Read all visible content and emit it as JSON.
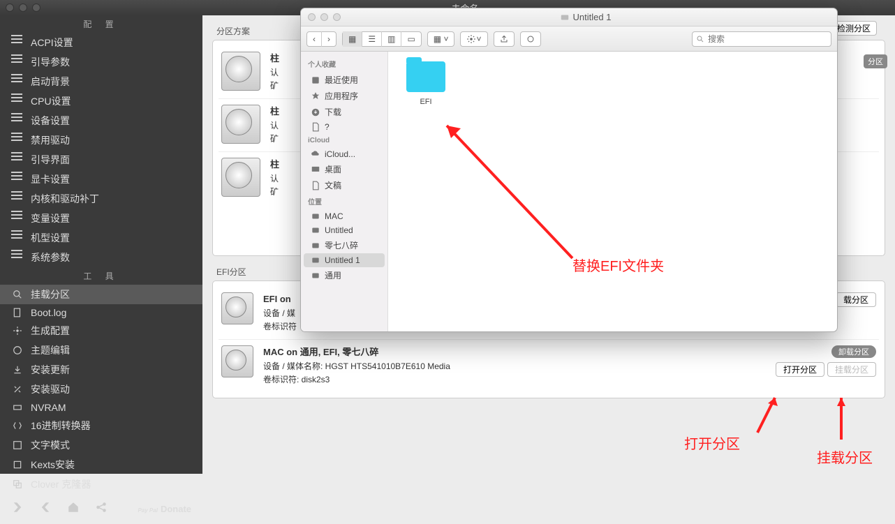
{
  "titlebar": {
    "title": "未命名"
  },
  "sidebar": {
    "section_config": "配  置",
    "section_tools": "工  具",
    "config_items": [
      "ACPI设置",
      "引导参数",
      "启动背景",
      "CPU设置",
      "设备设置",
      "禁用驱动",
      "引导界面",
      "显卡设置",
      "内核和驱动补丁",
      "变量设置",
      "机型设置",
      "系统参数"
    ],
    "tool_items": [
      "挂载分区",
      "Boot.log",
      "生成配置",
      "主题编辑",
      "安装更新",
      "安装驱动",
      "NVRAM",
      "16进制转换器",
      "文字模式",
      "Kexts安装",
      "Clover 克隆器"
    ],
    "donate": "Donate",
    "paypal": "Pay\nPal"
  },
  "content": {
    "partition_scheme": "分区方案",
    "detect": "检测分区",
    "efi_section": "EFI分区",
    "efi1": {
      "title": "EFI on",
      "media": "设备 / 媒",
      "vol": "卷标识符",
      "action": "载分区"
    },
    "efi2": {
      "title": "MAC on 通用, EFI, 零七八碎",
      "media": "设备 / 媒体名称: HGST HTS541010B7E610 Media",
      "vol": "卷标识符: disk2s3",
      "unmount": "卸载分区",
      "open": "打开分区",
      "mount": "挂载分区"
    },
    "side_badge": "分区"
  },
  "finder": {
    "title": "Untitled 1",
    "search_placeholder": "搜索",
    "sb": {
      "fav": "个人收藏",
      "fav_items": [
        "最近使用",
        "应用程序",
        "下载",
        "?"
      ],
      "icloud": "iCloud",
      "icloud_items": [
        "iCloud...",
        "桌面",
        "文稿"
      ],
      "loc": "位置",
      "loc_items": [
        "MAC",
        "Untitled",
        "零七八碎",
        "Untitled 1",
        "通用"
      ]
    },
    "folder": "EFI"
  },
  "annotations": {
    "replace_efi": "替换EFI文件夹",
    "open_part": "打开分区",
    "mount_part": "挂载分区"
  }
}
